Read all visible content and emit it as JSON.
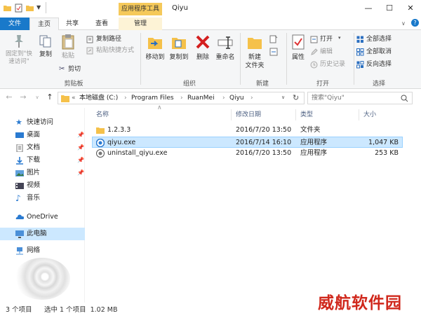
{
  "window": {
    "title": "Qiyu",
    "context_tab": "应用程序工具",
    "controls": {
      "minimize": "—",
      "maximize": "☐",
      "close": "✕"
    }
  },
  "ribbon_tabs": {
    "file": "文件",
    "home": "主页",
    "share": "共享",
    "view": "查看",
    "manage": "管理"
  },
  "ribbon": {
    "clipboard": {
      "pin_quick": "固定到\"快速访问\"",
      "copy": "复制",
      "paste": "粘贴",
      "cut": "剪切",
      "copy_path": "复制路径",
      "paste_shortcut": "粘贴快捷方式",
      "group": "剪贴板"
    },
    "organize": {
      "move_to": "移动到",
      "copy_to": "复制到",
      "delete": "删除",
      "rename": "重命名",
      "group": "组织"
    },
    "new": {
      "new_folder": "新建\n文件夹",
      "group": "新建"
    },
    "open": {
      "properties": "属性",
      "open": "打开",
      "edit": "编辑",
      "history": "历史记录",
      "group": "打开"
    },
    "select": {
      "select_all": "全部选择",
      "select_none": "全部取消",
      "invert": "反向选择",
      "group": "选择"
    }
  },
  "address": {
    "chevron": "«",
    "crumbs": [
      "本地磁盘 (C:)",
      "Program Files",
      "RuanMei",
      "Qiyu"
    ],
    "search_placeholder": "搜索\"Qiyu\""
  },
  "nav": [
    {
      "label": "快速访问",
      "icon": "star-icon"
    },
    {
      "label": "桌面",
      "icon": "desktop-icon",
      "pinned": true
    },
    {
      "label": "文档",
      "icon": "documents-icon",
      "pinned": true
    },
    {
      "label": "下载",
      "icon": "download-icon",
      "pinned": true
    },
    {
      "label": "图片",
      "icon": "pictures-icon",
      "pinned": true
    },
    {
      "label": "视频",
      "icon": "videos-icon"
    },
    {
      "label": "音乐",
      "icon": "music-icon"
    },
    {
      "label": "OneDrive",
      "icon": "onedrive-icon"
    },
    {
      "label": "此电脑",
      "icon": "pc-icon"
    },
    {
      "label": "网络",
      "icon": "network-icon"
    }
  ],
  "columns": {
    "name": "名称",
    "modified": "修改日期",
    "type": "类型",
    "size": "大小"
  },
  "files": [
    {
      "name": "1.2.3.3",
      "modified": "2016/7/20 13:50",
      "type": "文件夹",
      "size": ""
    },
    {
      "name": "qiyu.exe",
      "modified": "2016/7/14 16:10",
      "type": "应用程序",
      "size": "1,047 KB"
    },
    {
      "name": "uninstall_qiyu.exe",
      "modified": "2016/7/20 13:50",
      "type": "应用程序",
      "size": "253 KB"
    }
  ],
  "status": {
    "count": "3 个项目",
    "selected": "选中 1 个项目  1.02 MB"
  },
  "watermark": "威航软件园",
  "colors": {
    "accent": "#1979ca",
    "selection": "#cce8ff",
    "folder": "#f5c14a",
    "context_tab": "#f5c95a",
    "watermark": "#d0281c"
  }
}
